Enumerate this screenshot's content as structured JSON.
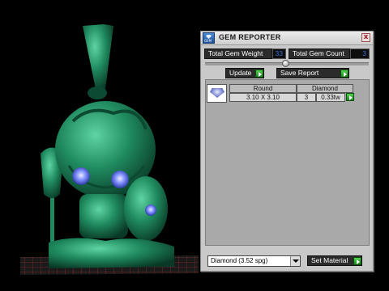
{
  "panel": {
    "title": "GEM REPORTER",
    "close_glyph": "x",
    "app_icon_caption": "GEM",
    "total_weight_label": "Total Gem Weight",
    "total_weight_value": "33",
    "total_count_label": "Total Gem Count",
    "total_count_value": "3",
    "update_label": "Update",
    "save_report_label": "Save Report"
  },
  "gem_list": {
    "columns": [
      "Round",
      "Diamond"
    ],
    "rows": [
      {
        "shape": "Round",
        "size": "3.10 X 3.10",
        "count": "3",
        "weight": "0.33tw",
        "material": "Diamond"
      }
    ]
  },
  "material": {
    "selected": "Diamond    (3.52 spg)",
    "set_label": "Set Material"
  },
  "icons": {
    "app": "gem-app-icon",
    "close": "close-icon",
    "go": "green-arrow-icon",
    "thumbnail": "round-diamond-icon",
    "dropdown": "chevron-down-icon"
  },
  "colors": {
    "model": "#1f8a5e",
    "gem_highlight": "#7d8cff",
    "button_dark": "#2b2b2b",
    "go_green": "#2fb12f",
    "value_blue": "#3a6fd0"
  }
}
